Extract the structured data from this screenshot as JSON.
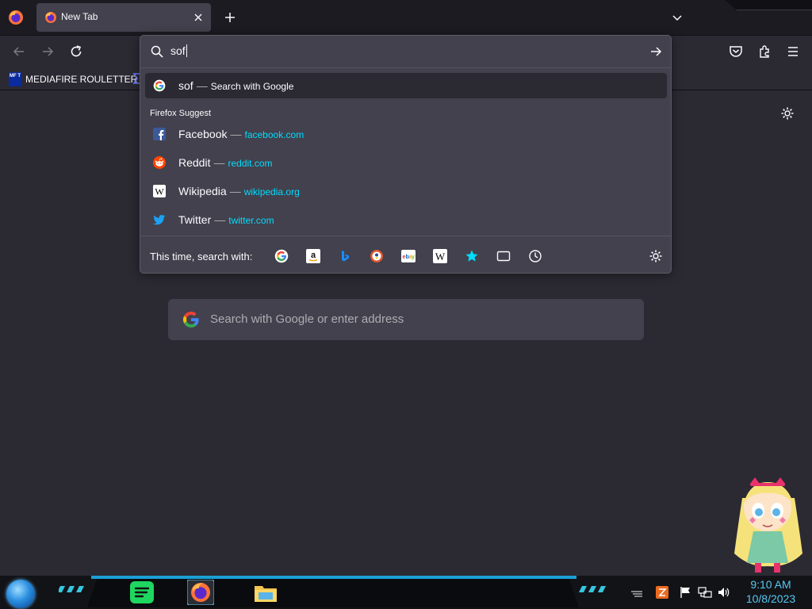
{
  "tabs": [
    {
      "title": "New Tab"
    }
  ],
  "bookmarks": [
    {
      "label": "MEDIAFIRE ROULETTER",
      "favicon_text": "MF T"
    }
  ],
  "urlbar": {
    "typed_text": "sof",
    "heuristic": {
      "query": "sof",
      "separator": "—",
      "action": "Search with Google"
    },
    "group_label": "Firefox Suggest",
    "suggestions": [
      {
        "title": "Facebook",
        "separator": "—",
        "url": "facebook.com",
        "icon": "facebook-icon"
      },
      {
        "title": "Reddit",
        "separator": "—",
        "url": "reddit.com",
        "icon": "reddit-icon"
      },
      {
        "title": "Wikipedia",
        "separator": "—",
        "url": "wikipedia.org",
        "icon": "wikipedia-icon"
      },
      {
        "title": "Twitter",
        "separator": "—",
        "url": "twitter.com",
        "icon": "twitter-icon"
      }
    ],
    "oneoff_label": "This time, search with:",
    "oneoff_engines": [
      "google-icon",
      "amazon-icon",
      "bing-icon",
      "duckduckgo-icon",
      "ebay-icon",
      "wikipedia-icon",
      "bookmarks-icon",
      "tabs-icon",
      "history-icon"
    ]
  },
  "newtab": {
    "search_placeholder": "Search with Google or enter address"
  },
  "taskbar": {
    "time": "9:10 AM",
    "date": "10/8/2023"
  },
  "colors": {
    "accent_url": "#00ddff",
    "taskbar_glow": "#1b9fd6",
    "clock": "#55c8f2"
  }
}
